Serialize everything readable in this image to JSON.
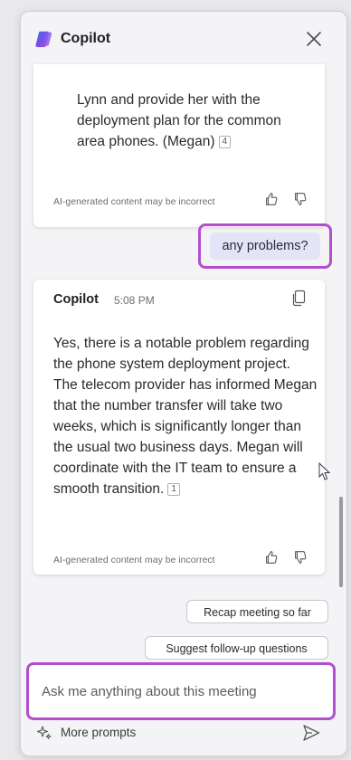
{
  "header": {
    "title": "Copilot",
    "logo_icon": "copilot-logo-icon",
    "close_icon": "close-icon"
  },
  "messages": {
    "prev_response": {
      "text": "Lynn and provide her with the deployment plan for the common area phones. (Megan)",
      "ref": "4",
      "disclaimer": "AI-generated content may be incorrect"
    },
    "user_message": {
      "text": "any problems?"
    },
    "response": {
      "sender": "Copilot",
      "time": "5:08 PM",
      "text": "Yes, there is a notable problem regarding the phone system deployment project. The telecom provider has informed Megan that the number transfer will take two weeks, which is significantly longer than the usual two business days. Megan will coordinate with the IT team to ensure a smooth transition.",
      "ref": "1",
      "disclaimer": "AI-generated content may be incorrect"
    }
  },
  "suggestions": {
    "recap": "Recap meeting so far",
    "follow_up": "Suggest follow-up questions"
  },
  "composer": {
    "placeholder": "Ask me anything about this meeting",
    "more_prompts": "More prompts",
    "send_icon": "send-icon"
  },
  "colors": {
    "highlight": "#b44ed0",
    "user_bubble": "#e3e4f5",
    "panel_bg": "#f4f4f6"
  }
}
